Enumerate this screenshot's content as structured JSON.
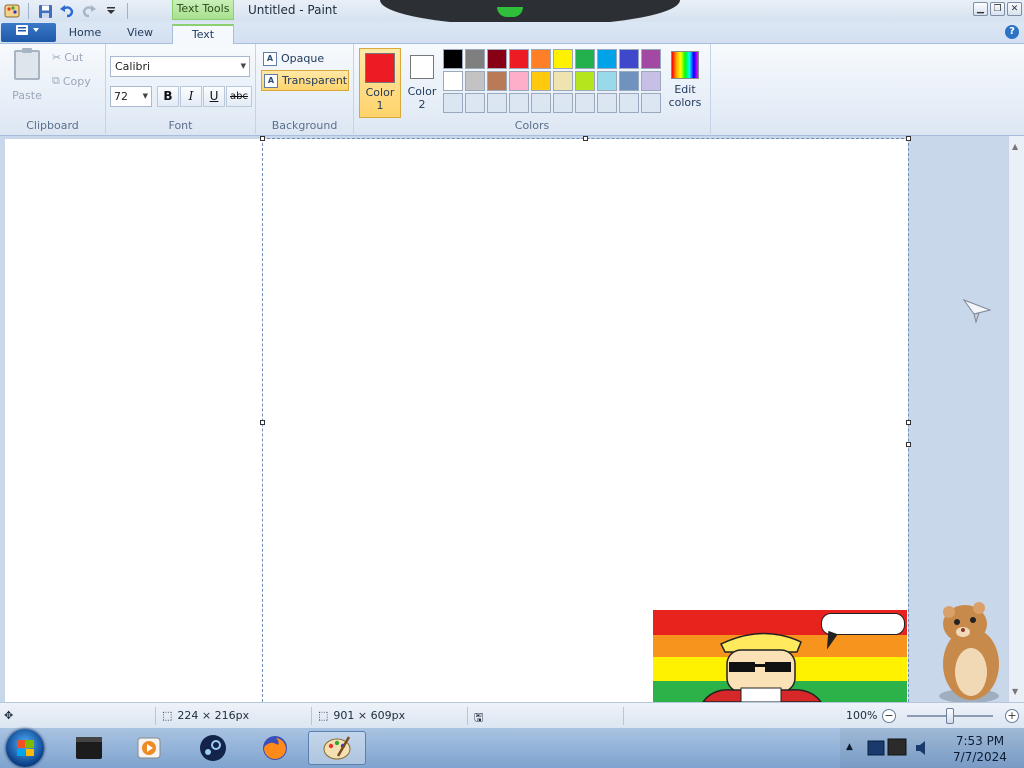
{
  "window": {
    "title": "Untitled - Paint",
    "contextual_tab": "Text Tools"
  },
  "tabs": {
    "home": "Home",
    "view": "View",
    "text": "Text"
  },
  "clipboard": {
    "group_label": "Clipboard",
    "paste": "Paste",
    "cut": "Cut",
    "copy": "Copy"
  },
  "font": {
    "group_label": "Font",
    "family": "Calibri",
    "size": "72",
    "bold": "B",
    "italic": "I",
    "underline": "U",
    "strikethrough": "abc"
  },
  "background": {
    "group_label": "Background",
    "opaque": "Opaque",
    "transparent": "Transparent",
    "selected": "transparent"
  },
  "colors": {
    "group_label": "Colors",
    "color1_label_a": "Color",
    "color1_label_b": "1",
    "color1_value": "#ed1c24",
    "color2_label_a": "Color",
    "color2_label_b": "2",
    "color2_value": "#ffffff",
    "edit_label_a": "Edit",
    "edit_label_b": "colors",
    "palette_row1": [
      "#000000",
      "#7f7f7f",
      "#880015",
      "#ed1c24",
      "#ff7f27",
      "#fff200",
      "#22b14c",
      "#00a2e8",
      "#3f48cc",
      "#a349a4"
    ],
    "palette_row2": [
      "#ffffff",
      "#c3c3c3",
      "#b97a57",
      "#ffaec9",
      "#ffc90e",
      "#efe4b0",
      "#b5e61d",
      "#99d9ea",
      "#7092be",
      "#c8bfe7"
    ],
    "palette_row3": [
      "#dce6f2",
      "#dce6f2",
      "#dce6f2",
      "#dce6f2",
      "#dce6f2",
      "#dce6f2",
      "#dce6f2",
      "#dce6f2",
      "#dce6f2",
      "#dce6f2"
    ]
  },
  "status": {
    "selection_size": "224 × 216px",
    "image_size": "901 × 609px",
    "zoom": "100%"
  },
  "clock": {
    "time": "7:53 PM",
    "date": "7/7/2024"
  }
}
